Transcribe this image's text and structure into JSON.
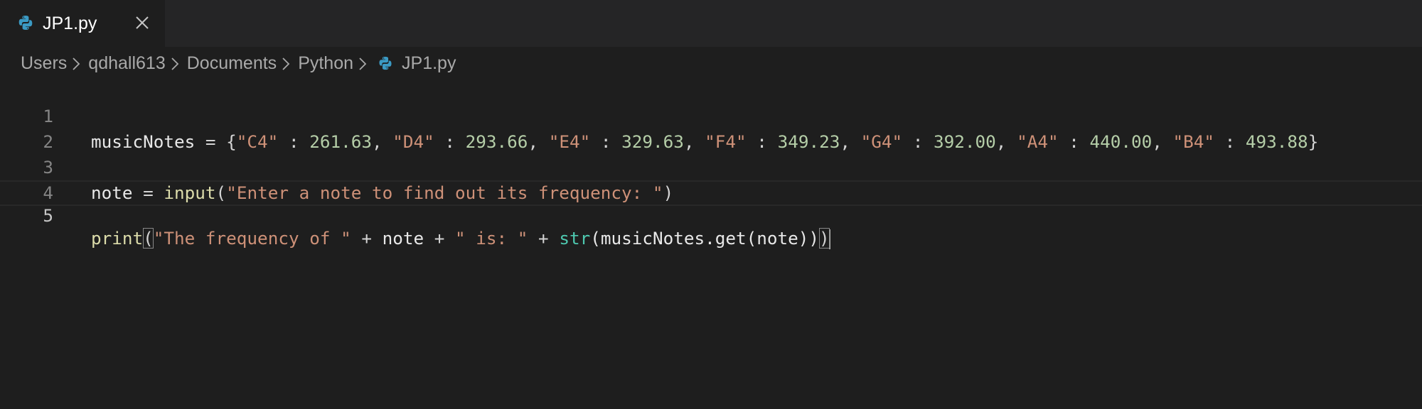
{
  "tab": {
    "label": "JP1.py",
    "icon": "python-icon",
    "close_icon": "close-icon"
  },
  "breadcrumb": {
    "items": [
      "Users",
      "qdhall613",
      "Documents",
      "Python"
    ],
    "file": "JP1.py"
  },
  "editor": {
    "line_numbers": [
      "1",
      "2",
      "3",
      "4",
      "5"
    ],
    "lines": {
      "l1": {
        "var": "musicNotes",
        "op1": " = {",
        "k1": "\"C4\"",
        "s1": " : ",
        "v1": "261.63",
        "c1": ", ",
        "k2": "\"D4\"",
        "s2": " : ",
        "v2": "293.66",
        "c2": ", ",
        "k3": "\"E4\"",
        "s3": " : ",
        "v3": "329.63",
        "c3": ", ",
        "k4": "\"F4\"",
        "s4": " : ",
        "v4": "349.23",
        "c4": ", ",
        "k5": "\"G4\"",
        "s5": " : ",
        "v5": "392.00",
        "c5": ", ",
        "k6": "\"A4\"",
        "s6": " : ",
        "v6": "440.00",
        "c6": ", ",
        "k7": "\"B4\"",
        "s7": " : ",
        "v7": "493.88",
        "close": "}"
      },
      "l3": {
        "var": "note",
        "op1": " = ",
        "fn": "input",
        "open": "(",
        "str": "\"Enter a note to find out its frequency: \"",
        "close": ")"
      },
      "l5": {
        "fn": "print",
        "open": "(",
        "str1": "\"The frequency of \"",
        "op1": " + ",
        "var1": "note",
        "op2": " + ",
        "str2": "\" is: \"",
        "op3": " + ",
        "bi": "str",
        "mid": "(musicNotes.get(note))",
        "close": ")"
      }
    }
  },
  "colors": {
    "background": "#1e1e1e",
    "string": "#ce9178",
    "number": "#b5cea8",
    "function": "#dcdcaa",
    "builtin": "#4ec9b0",
    "python_icon": "#3b9ac4"
  }
}
